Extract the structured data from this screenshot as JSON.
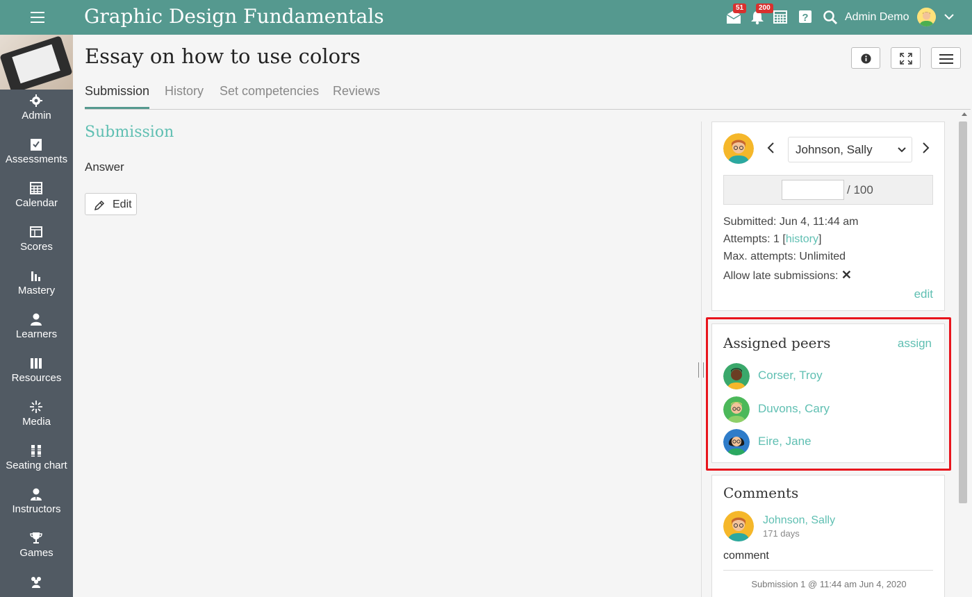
{
  "app": {
    "title": "Graphic Design Fundamentals"
  },
  "topbar": {
    "messages_badge": "51",
    "notifications_badge": "200",
    "user_name": "Admin Demo"
  },
  "sidebar": {
    "items": [
      {
        "label": "Admin",
        "icon": "gear-icon"
      },
      {
        "label": "Assessments",
        "icon": "checklist-icon"
      },
      {
        "label": "Calendar",
        "icon": "calendar-icon"
      },
      {
        "label": "Scores",
        "icon": "gradebook-icon"
      },
      {
        "label": "Mastery",
        "icon": "bar-chart-icon"
      },
      {
        "label": "Learners",
        "icon": "user-icon"
      },
      {
        "label": "Resources",
        "icon": "books-icon"
      },
      {
        "label": "Media",
        "icon": "sparkle-icon"
      },
      {
        "label": "Seating chart",
        "icon": "seats-icon"
      },
      {
        "label": "Instructors",
        "icon": "instructor-icon"
      },
      {
        "label": "Games",
        "icon": "trophy-icon"
      },
      {
        "label": "",
        "icon": "group-icon"
      }
    ]
  },
  "page": {
    "title": "Essay on how to use colors",
    "tabs": [
      "Submission",
      "History",
      "Set competencies",
      "Reviews"
    ],
    "active_tab": "Submission"
  },
  "submission": {
    "heading": "Submission",
    "answer_label": "Answer",
    "edit_label": "Edit"
  },
  "grading": {
    "selected_student": "Johnson, Sally",
    "grade_value": "",
    "grade_max": "/ 100",
    "submitted": "Submitted: Jun 4, 11:44 am",
    "attempts_prefix": "Attempts: 1 [",
    "attempts_link": "history",
    "attempts_suffix": "]",
    "max_attempts": "Max. attempts: Unlimited",
    "late_label": "Allow late submissions:",
    "late_value": "✕",
    "edit_link": "edit"
  },
  "peers": {
    "title": "Assigned peers",
    "assign_label": "assign",
    "items": [
      {
        "name": "Corser, Troy"
      },
      {
        "name": "Duvons, Cary"
      },
      {
        "name": "Eire, Jane"
      }
    ]
  },
  "comments": {
    "title": "Comments",
    "author": "Johnson, Sally",
    "time": "171 days",
    "text": "comment",
    "footer": "Submission 1 @ 11:44 am Jun 4, 2020"
  },
  "colors": {
    "topbar": "#55998f",
    "sidebar": "#515a63",
    "accent": "#5fbfb2",
    "highlight": "#e8141c",
    "badge": "#d9312e"
  }
}
